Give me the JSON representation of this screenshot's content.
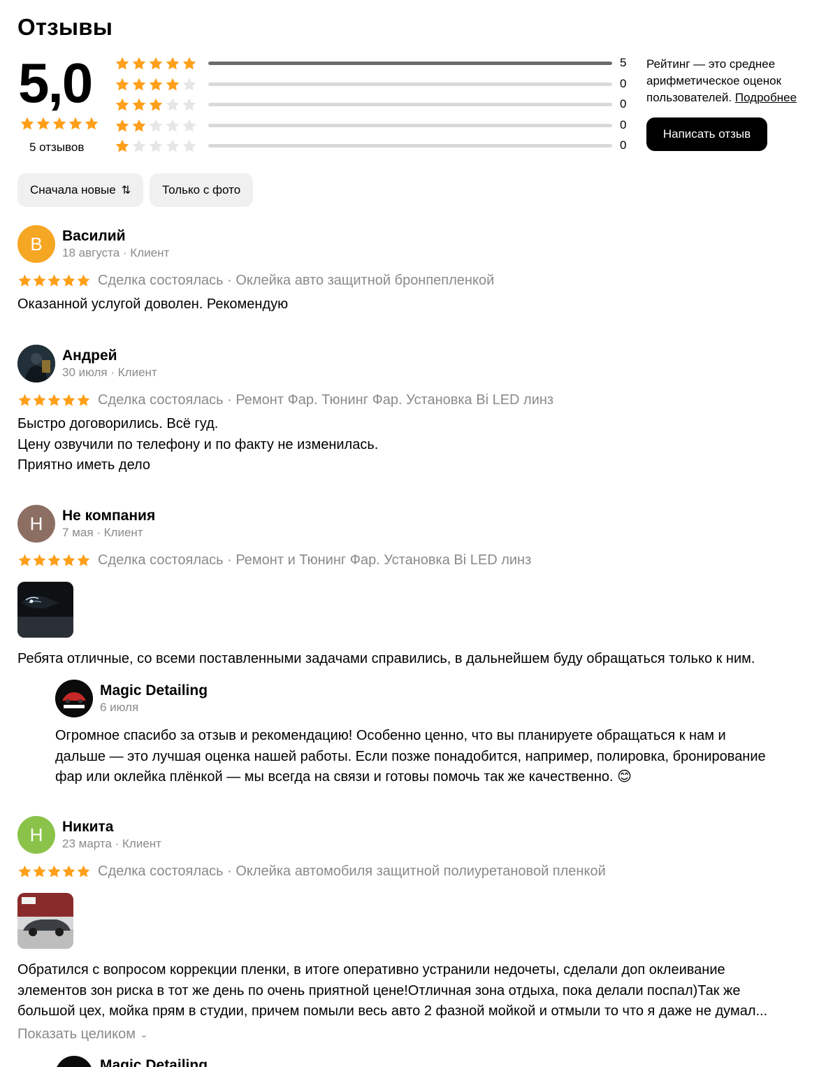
{
  "page": {
    "title": "Отзывы"
  },
  "summary": {
    "score": "5,0",
    "stars": 5,
    "reviews_count": "5 отзывов",
    "breakdown": [
      {
        "stars": 5,
        "count": "5",
        "fraction": 1.0
      },
      {
        "stars": 4,
        "count": "0",
        "fraction": 0.0
      },
      {
        "stars": 3,
        "count": "0",
        "fraction": 0.0
      },
      {
        "stars": 2,
        "count": "0",
        "fraction": 0.0
      },
      {
        "stars": 1,
        "count": "0",
        "fraction": 0.0
      }
    ],
    "info_text": "Рейтинг — это среднее арифметическое оценок пользователей.",
    "info_link": "Подробнее",
    "write_button": "Написать отзыв"
  },
  "filters": {
    "sort_label": "Сначала новые",
    "photo_label": "Только с фото"
  },
  "reviews": [
    {
      "author": "Василий",
      "initial": "В",
      "avatar_color": "#f5a623",
      "date": "18 августа",
      "role": "Клиент",
      "deal": "Сделка состоялась",
      "service": "Оклейка авто защитной бронпепленкой",
      "text_lines": [
        "Оказанной услугой доволен. Рекомендую"
      ]
    },
    {
      "author": "Андрей",
      "initial": "",
      "avatar_color": "#1f2a33",
      "date": "30 июля",
      "role": "Клиент",
      "deal": "Сделка состоялась",
      "service": "Ремонт Фар. Тюнинг Фар. Установка Bi LED линз",
      "text_lines": [
        "Быстро договорились. Всё гуд.",
        "Цену озвучили по телефону и по факту не изменилась.",
        "Приятно иметь дело"
      ]
    },
    {
      "author": "Не компания",
      "initial": "Н",
      "avatar_color": "#8d6e63",
      "date": "7 мая",
      "role": "Клиент",
      "deal": "Сделка состоялась",
      "service": "Ремонт и Тюнинг Фар. Установка Bi LED линз",
      "text_lines": [
        "Ребята отличные, со всеми поставленными задачами справились, в дальнейшем буду обращаться только к ним."
      ],
      "reply": {
        "author": "Magic Detailing",
        "date": "6 июля",
        "text_lines": [
          "Огромное спасибо за отзыв и рекомендацию! Особенно ценно, что вы планируете обращаться к нам и",
          "дальше — это лучшая оценка нашей работы. Если позже понадобится, например, полировка, бронирование",
          "фар или оклейка плёнкой — мы всегда на связи и готовы помочь так же качественно. 😊"
        ]
      }
    },
    {
      "author": "Никита",
      "initial": "Н",
      "avatar_color": "#8bc34a",
      "date": "23 марта",
      "role": "Клиент",
      "deal": "Сделка состоялась",
      "service": "Оклейка автомобиля защитной полиуретановой пленкой",
      "text_lines": [
        "Обратился с вопросом коррекции пленки, в итоге оперативно устранили недочеты, сделали доп оклеивание",
        "элементов зон риска в тот же день по очень приятной цене!Отличная зона отдыха, пока делали поспал)Так же",
        "большой цех, мойка прям в студии, причем помыли весь авто 2 фазной мойкой и отмыли то что я даже не думал..."
      ],
      "show_more": "Показать целиком"
    }
  ],
  "next_reply_author": "Magic Detailing",
  "colors": {
    "star": "#ff9f1a",
    "star_empty": "#e6e6e6",
    "button": "#000000",
    "chip": "#f0f0f0",
    "muted": "#8a8a8a"
  }
}
